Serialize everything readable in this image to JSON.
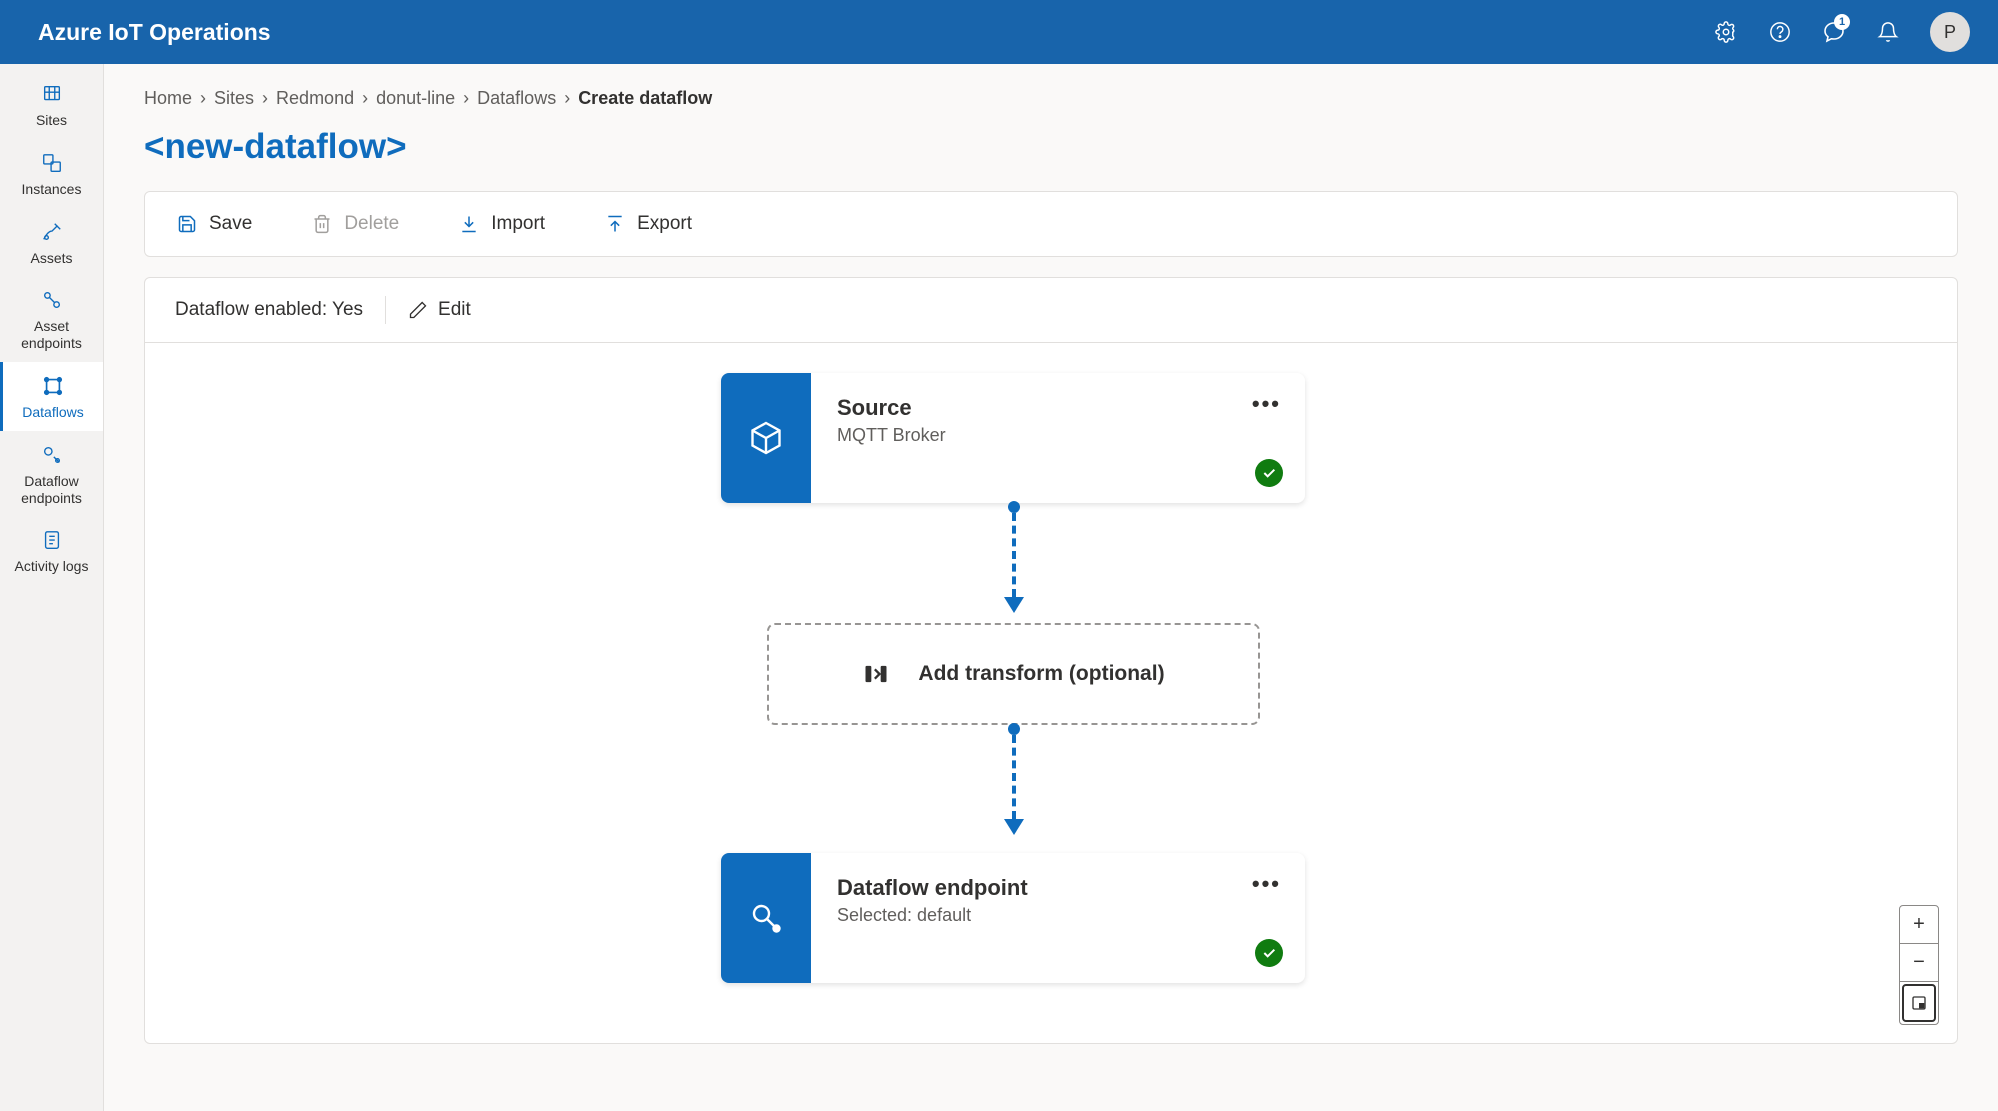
{
  "header": {
    "title": "Azure IoT Operations",
    "notification_badge": "1",
    "avatar_initial": "P"
  },
  "sidebar": {
    "items": [
      {
        "label": "Sites"
      },
      {
        "label": "Instances"
      },
      {
        "label": "Assets"
      },
      {
        "label": "Asset endpoints"
      },
      {
        "label": "Dataflows"
      },
      {
        "label": "Dataflow endpoints"
      },
      {
        "label": "Activity logs"
      }
    ]
  },
  "breadcrumb": {
    "items": [
      "Home",
      "Sites",
      "Redmond",
      "donut-line",
      "Dataflows"
    ],
    "current": "Create dataflow"
  },
  "page": {
    "title": "<new-dataflow>"
  },
  "toolbar": {
    "save": "Save",
    "delete": "Delete",
    "import": "Import",
    "export": "Export"
  },
  "canvas": {
    "enabled_label": "Dataflow enabled: Yes",
    "edit": "Edit",
    "source": {
      "title": "Source",
      "subtitle": "MQTT Broker"
    },
    "transform": {
      "label": "Add transform (optional)"
    },
    "endpoint": {
      "title": "Dataflow endpoint",
      "subtitle": "Selected: default"
    }
  }
}
